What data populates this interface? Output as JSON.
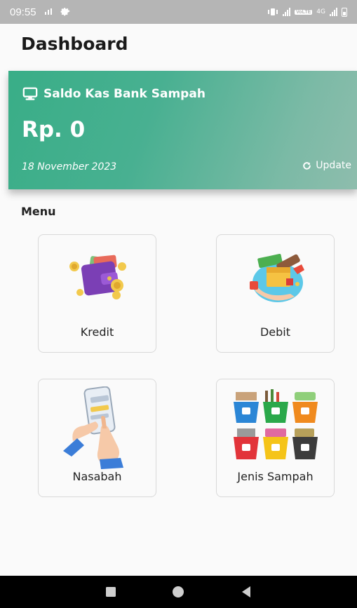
{
  "status_bar": {
    "time": "09:55",
    "volte": "VoLTE",
    "network": "4G"
  },
  "header": {
    "title": "Dashboard"
  },
  "balance_card": {
    "title": "Saldo Kas Bank Sampah",
    "amount": "Rp. 0",
    "date": "18 November 2023",
    "update_label": "Update",
    "gradient_start": "#39ae87",
    "gradient_end": "#8ebdad"
  },
  "menu": {
    "label": "Menu",
    "items": [
      {
        "label": "Kredit",
        "icon": "wallet-coins-illustration"
      },
      {
        "label": "Debit",
        "icon": "cash-box-hand-illustration"
      },
      {
        "label": "Nasabah",
        "icon": "hand-phone-illustration"
      },
      {
        "label": "Jenis Sampah",
        "icon": "recycle-bins-illustration"
      }
    ]
  },
  "nav_bar": {
    "buttons": [
      "recents-icon",
      "home-icon",
      "back-icon"
    ]
  }
}
